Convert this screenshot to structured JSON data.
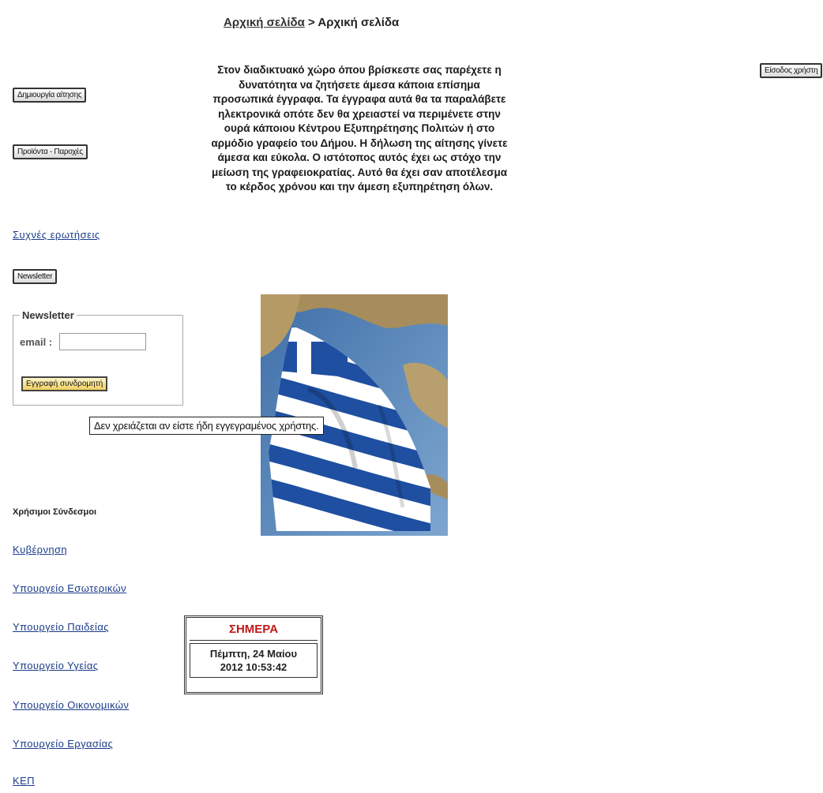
{
  "breadcrumb": {
    "home_link": "Αρχική σελίδα",
    "separator": ">",
    "current": "Αρχική σελίδα"
  },
  "buttons": {
    "create_application": "Δημιουργία αίτησης",
    "products_services": "Προϊόντα - Παροχές",
    "newsletter": "Newsletter",
    "login": "Είσοδος χρήστη"
  },
  "faq_link": "Συχνές ερωτήσεις",
  "intro_text": "Στον διαδικτυακό χώρο όπου βρίσκεστε σας παρέχετε η δυνατότητα να ζητήσετε άμεσα κάποια επίσημα προσωπικά έγγραφα. Τα έγγραφα αυτά θα τα παραλάβετε ηλεκτρονικά οπότε δεν θα χρειαστεί να περιμένετε στην ουρά κάποιου Κέντρου Εξυπηρέτησης Πολιτών ή στο αρμόδιο γραφείο του Δήμου. Η δήλωση της αίτησης γίνετε άμεσα και εύκολα. Ο ιστότοπος αυτός έχει ως στόχο την μείωση της γραφειοκρατίας. Αυτό θα έχει σαν αποτέλεσμα το κέρδος χρόνου και την άμεση εξυπηρέτηση όλων.",
  "newsletter": {
    "legend": "Newsletter",
    "email_label": "email :",
    "email_value": "",
    "subscribe_label": "Εγγραφή συνδρομητή"
  },
  "tooltip": "Δεν χρειάζεται αν είστε ήδη εγγεγραμένος χρήστης.",
  "useful_links": {
    "heading": "Χρήσιμοι Σύνδεσμοι",
    "items": [
      "Κυβέρνηση",
      "Υπουργείο Εσωτερικών",
      "Υπουργείο Παιδείας",
      "Υπουργείο Υγείας",
      "Υπουργείο Οικονομικών",
      "Υπουργείο Εργασίας",
      "ΚΕΠ"
    ]
  },
  "date_widget": {
    "header": "ΣΗΜΕΡΑ",
    "line1": "Πέμπτη, 24 Μαίου",
    "line2": "2012 10:53:42"
  },
  "colors": {
    "link": "#1b3c8a",
    "date_header": "#c01818",
    "flag_blue": "#1f4fa0",
    "sea": "#5b86b8"
  },
  "image": {
    "icon": "greek-flag-map-image"
  }
}
